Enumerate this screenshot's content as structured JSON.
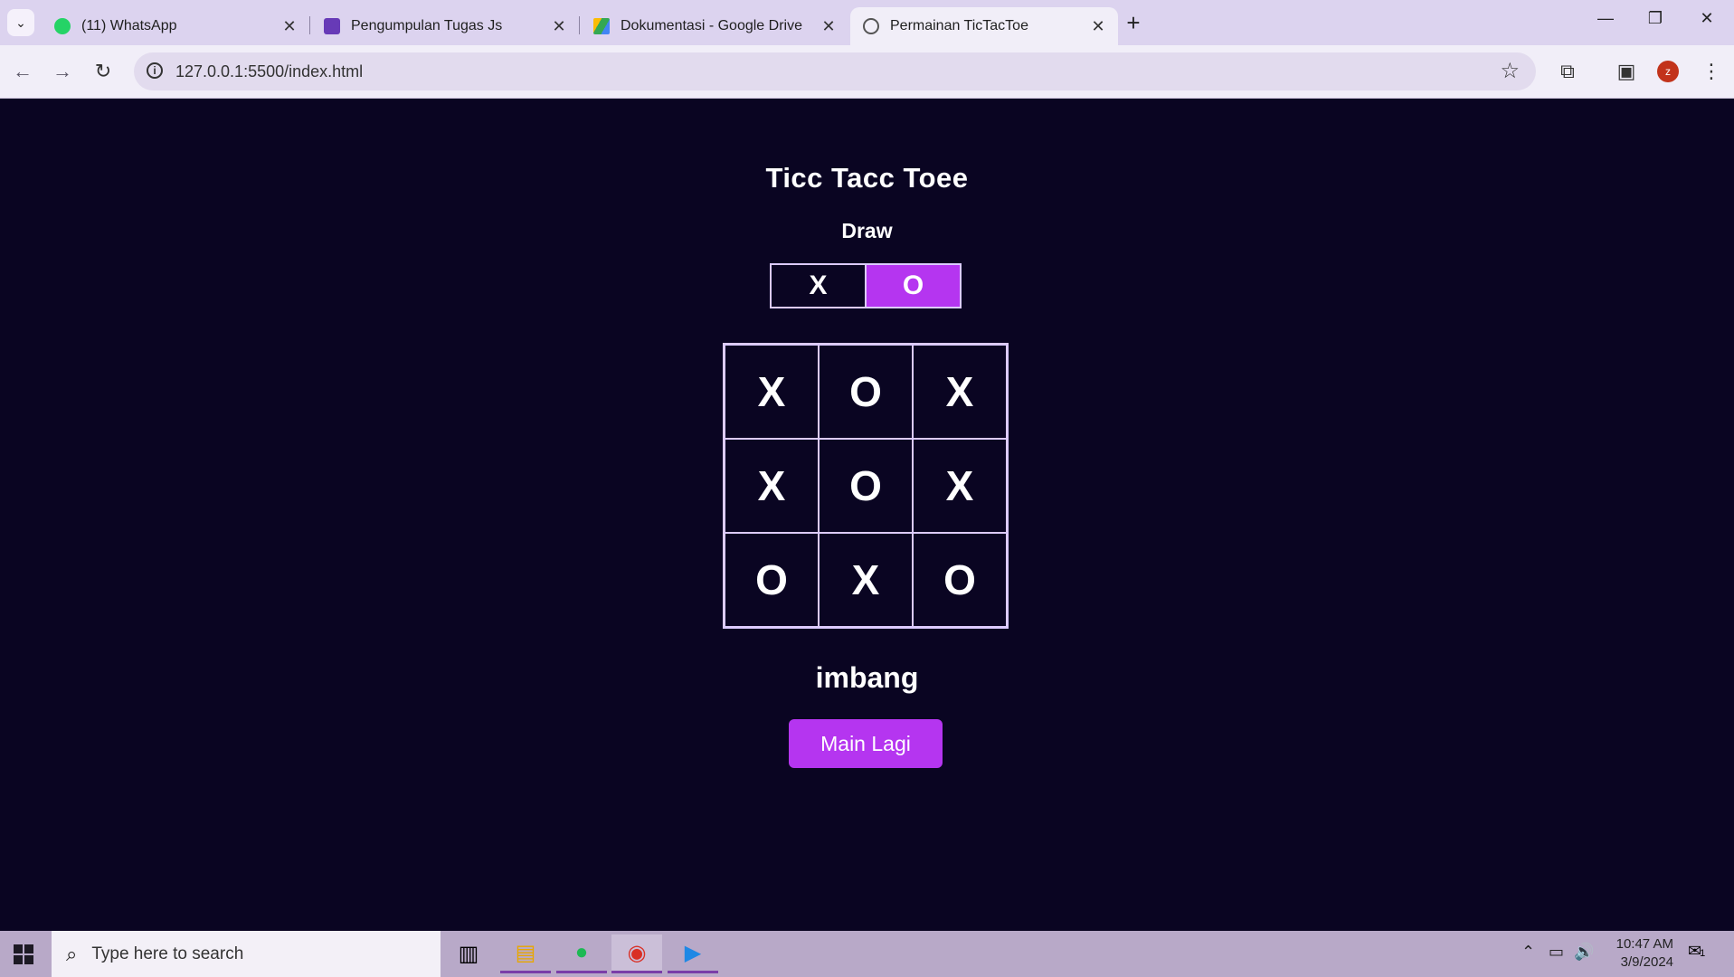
{
  "browser": {
    "tabs": [
      {
        "label": "(11) WhatsApp",
        "favicon": "whatsapp-icon",
        "color": "#25d366"
      },
      {
        "label": "Pengumpulan Tugas Js",
        "favicon": "forms-icon",
        "color": "#673ab7"
      },
      {
        "label": "Dokumentasi - Google Drive",
        "favicon": "drive-icon",
        "color": "#fbbc04"
      },
      {
        "label": "Permainan TicTacToe",
        "favicon": "globe-icon",
        "color": "#555555"
      }
    ],
    "active_tab": 3,
    "url": "127.0.0.1:5500/index.html",
    "profile_initial": "z"
  },
  "game": {
    "title": "Ticc Tacc Toee",
    "status": "Draw",
    "turn": {
      "x_label": "X",
      "o_label": "O",
      "active": "O"
    },
    "board": [
      "X",
      "O",
      "X",
      "X",
      "O",
      "X",
      "O",
      "X",
      "O"
    ],
    "result": "imbang",
    "play_again_label": "Main Lagi",
    "accent_color": "#b535f0",
    "background_color": "#0a0522"
  },
  "taskbar": {
    "search_placeholder": "Type here to search",
    "time": "10:47 AM",
    "date": "3/9/2024",
    "notification_count": "1"
  }
}
